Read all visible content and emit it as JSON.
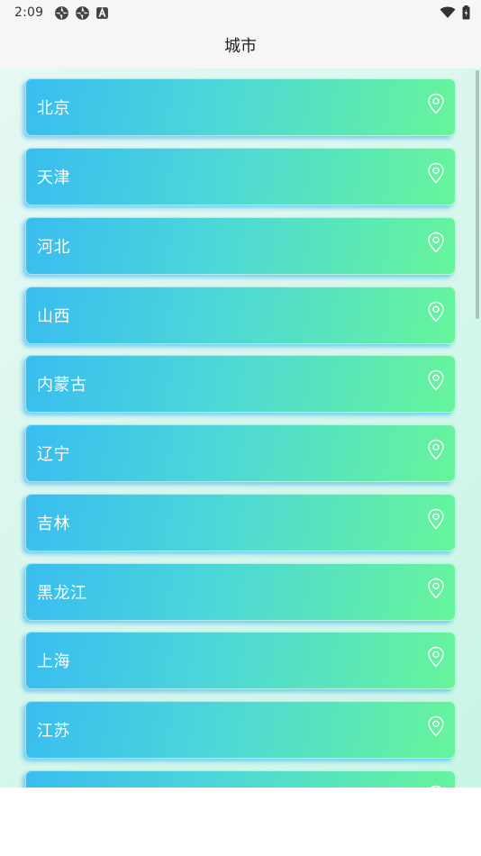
{
  "status_bar": {
    "time": "2:09",
    "left_icons": [
      "aperture-icon",
      "aperture-icon",
      "a-box-icon"
    ],
    "right_icons": [
      "wifi-icon",
      "battery-icon"
    ]
  },
  "app_bar": {
    "title": "城市"
  },
  "cities": [
    {
      "name": "北京",
      "icon": "location-pin-icon"
    },
    {
      "name": "天津",
      "icon": "location-pin-icon"
    },
    {
      "name": "河北",
      "icon": "location-pin-icon"
    },
    {
      "name": "山西",
      "icon": "location-pin-icon"
    },
    {
      "name": "内蒙古",
      "icon": "location-pin-icon"
    },
    {
      "name": "辽宁",
      "icon": "location-pin-icon"
    },
    {
      "name": "吉林",
      "icon": "location-pin-icon"
    },
    {
      "name": "黑龙江",
      "icon": "location-pin-icon"
    },
    {
      "name": "上海",
      "icon": "location-pin-icon"
    },
    {
      "name": "江苏",
      "icon": "location-pin-icon"
    },
    {
      "name": "",
      "icon": "location-pin-icon"
    }
  ],
  "colors": {
    "card_gradient_start": "#38bdf0",
    "card_gradient_end": "#66f59a",
    "background_start": "#e6f8f4",
    "background_end": "#c9f6e6"
  }
}
